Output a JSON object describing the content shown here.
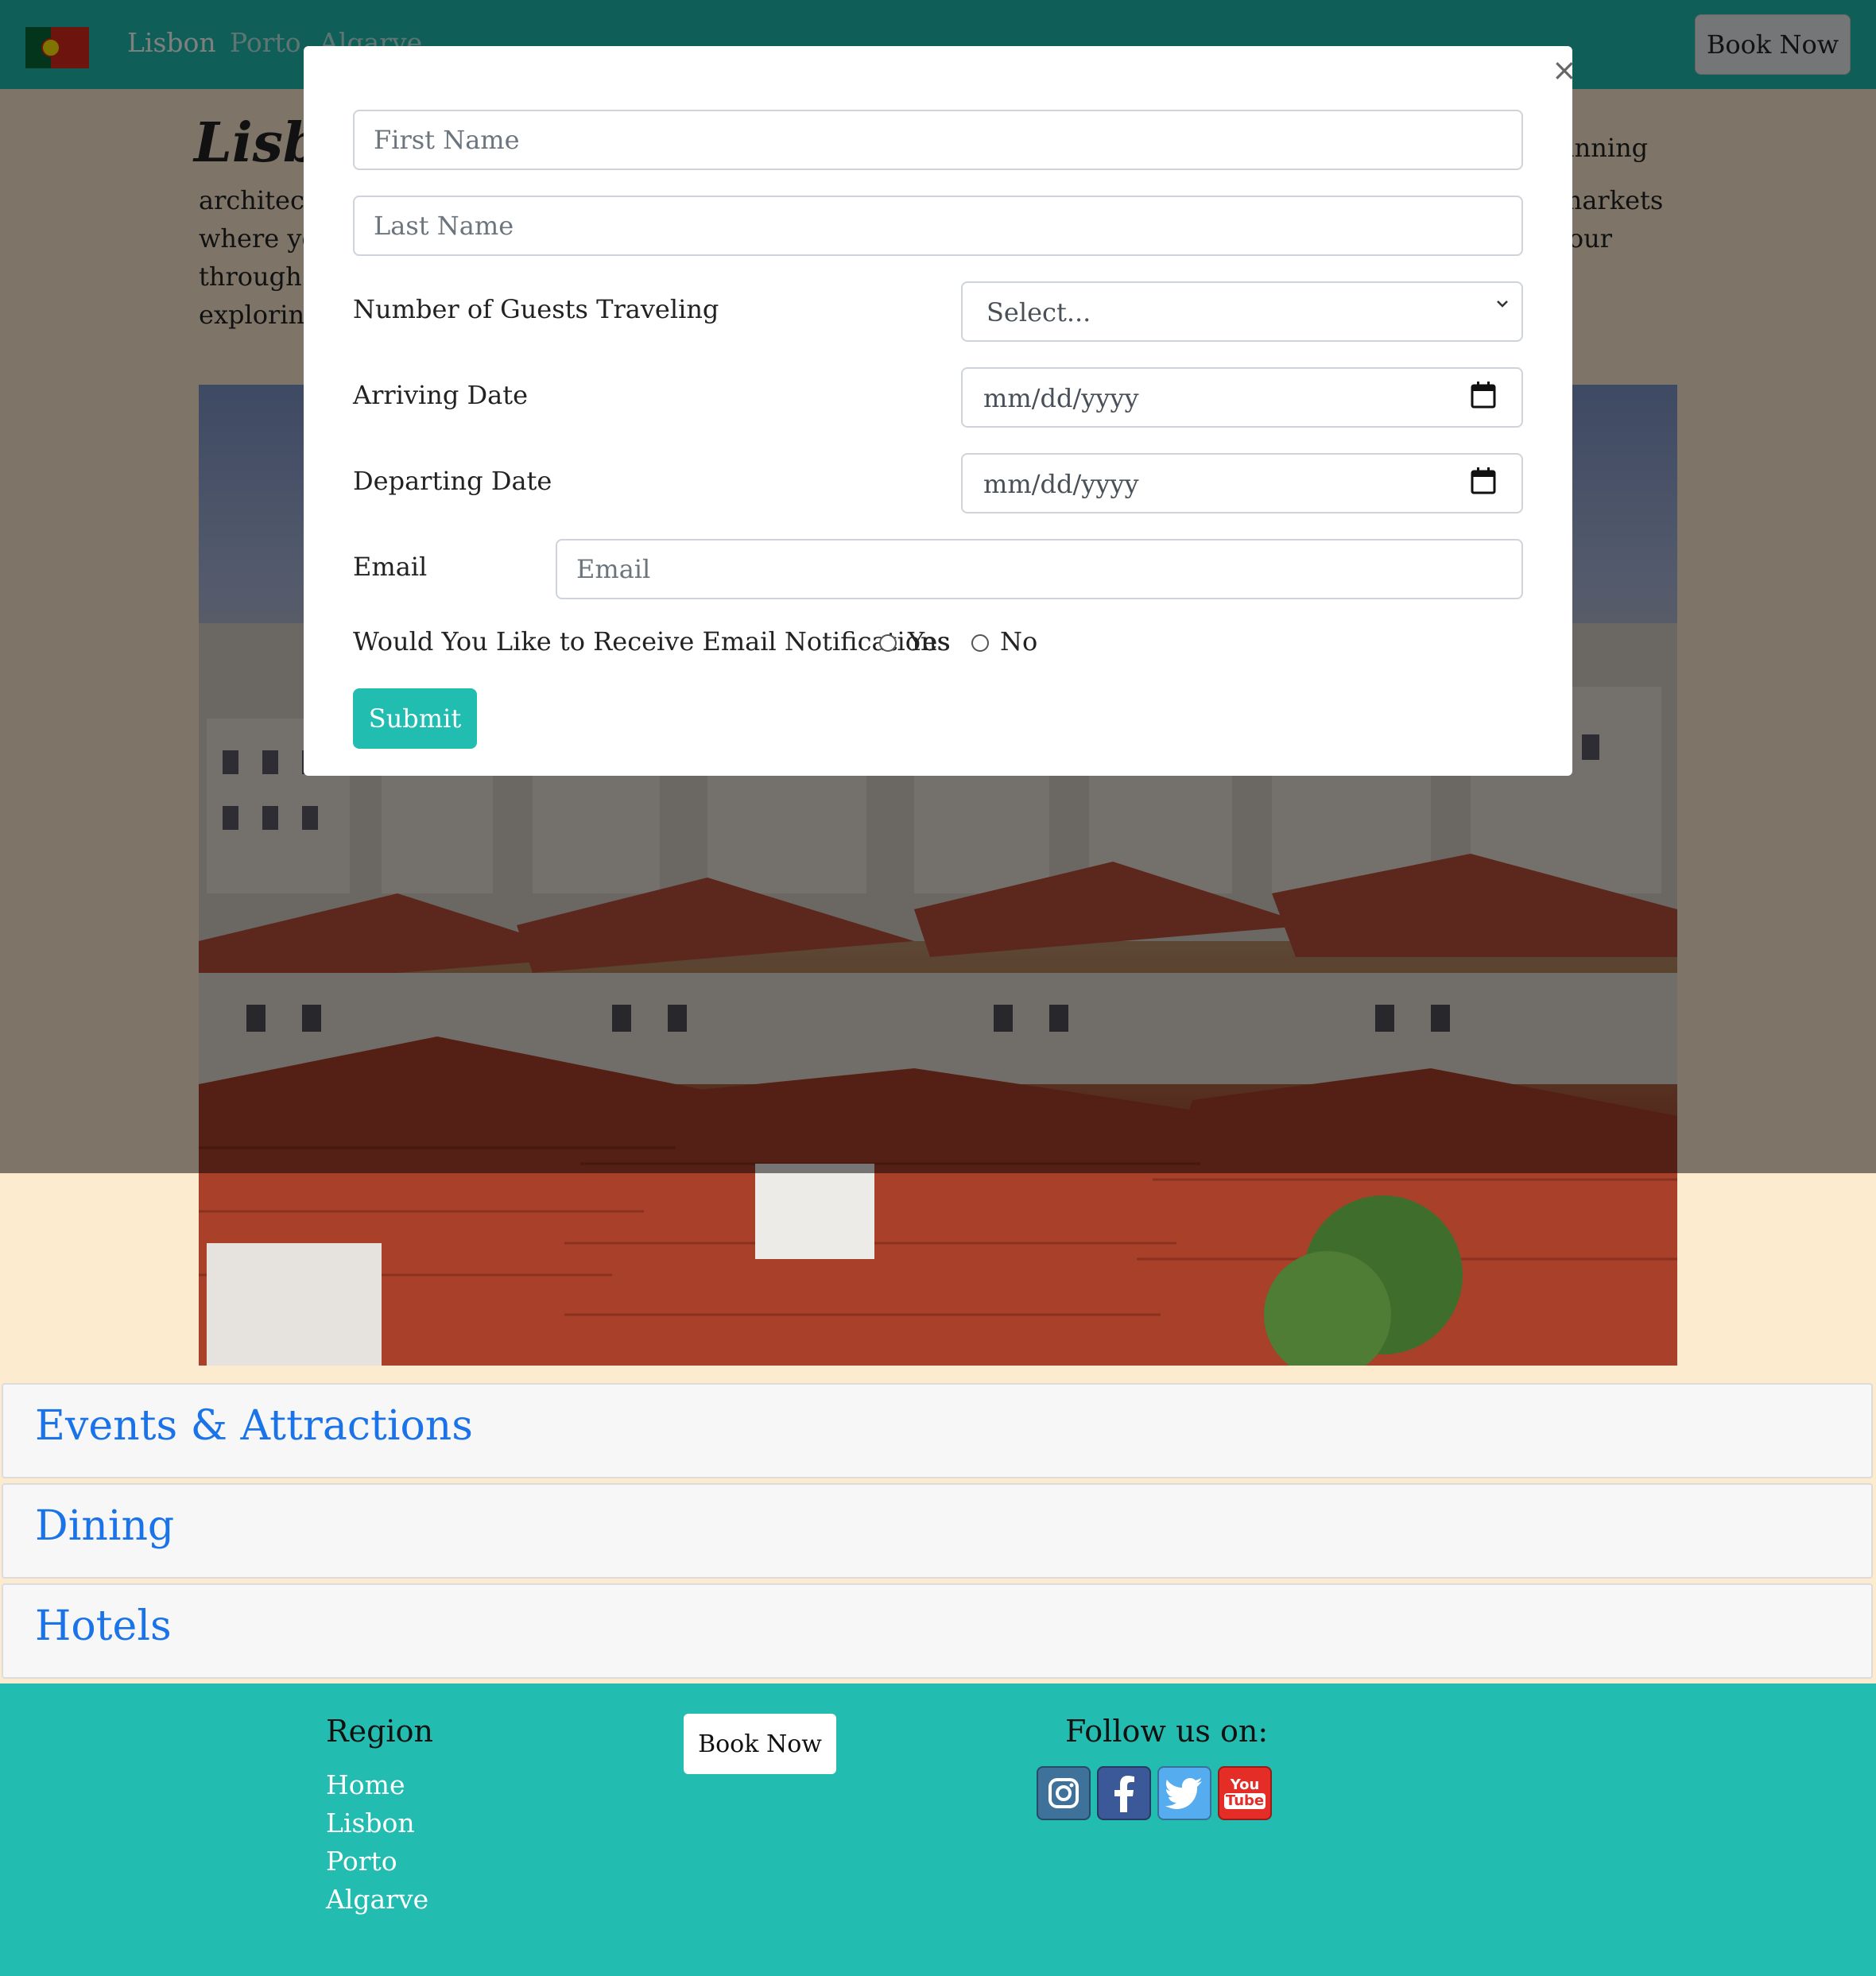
{
  "nav": {
    "links": [
      "Lisbon",
      "Porto",
      "Algarve"
    ],
    "book_label": "Book Now"
  },
  "intro": {
    "title": "Lisbon",
    "text_left": [
      "architectu",
      "where yo",
      "through s",
      "exploring"
    ],
    "text_right": [
      "unning",
      "markets",
      "tour"
    ]
  },
  "accordion": {
    "items": [
      "Events & Attractions",
      "Dining",
      "Hotels"
    ]
  },
  "footer": {
    "region_heading": "Region",
    "links": [
      "Home",
      "Lisbon",
      "Porto",
      "Algarve"
    ],
    "book_label": "Book Now",
    "follow_heading": "Follow us on:",
    "social": [
      {
        "name": "instagram-icon",
        "color": "#3f729b"
      },
      {
        "name": "facebook-icon",
        "color": "#3b5998"
      },
      {
        "name": "twitter-icon",
        "color": "#55acee"
      },
      {
        "name": "youtube-icon",
        "color": "#e52d27"
      }
    ]
  },
  "modal": {
    "close_label": "×",
    "first_name_placeholder": "First Name",
    "last_name_placeholder": "Last Name",
    "guests_label": "Number of Guests Traveling",
    "guests_value": "Select...",
    "arriving_label": "Arriving Date",
    "arriving_value": "mm/dd/yyyy",
    "departing_label": "Departing Date",
    "departing_value": "mm/dd/yyyy",
    "email_label": "Email",
    "email_placeholder": "Email",
    "notify_label": "Would You Like to Receive Email Notifications",
    "yes_label": "Yes",
    "no_label": "No",
    "submit_label": "Submit"
  },
  "colors": {
    "nav_bg": "#20bdb0",
    "accent": "#20bdb0",
    "link": "#1a73e8",
    "page_bg": "#fdebd0"
  }
}
